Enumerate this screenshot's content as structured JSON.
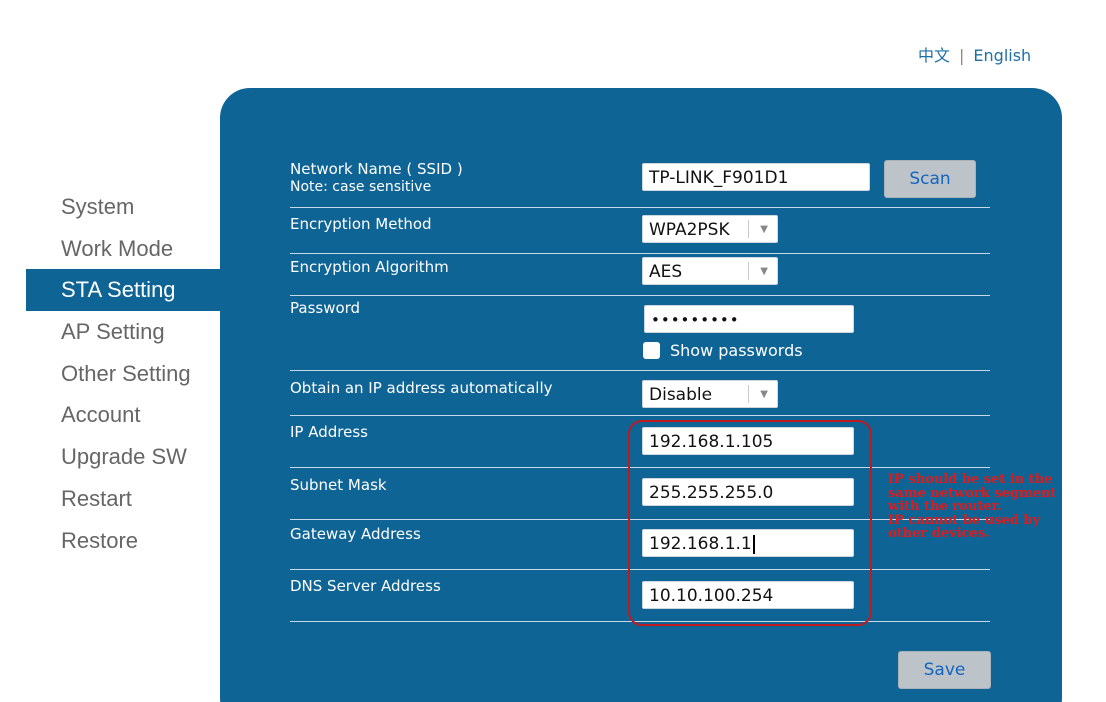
{
  "language": {
    "chinese": "中文",
    "separator": "|",
    "english": "English"
  },
  "sidebar": {
    "items": [
      {
        "label": "System"
      },
      {
        "label": "Work Mode"
      },
      {
        "label": "STA Setting",
        "active": true
      },
      {
        "label": "AP Setting"
      },
      {
        "label": "Other Setting"
      },
      {
        "label": "Account"
      },
      {
        "label": "Upgrade SW"
      },
      {
        "label": "Restart"
      },
      {
        "label": "Restore"
      }
    ]
  },
  "form": {
    "ssid": {
      "label": "Network Name ( SSID )",
      "note": "Note: case sensitive",
      "value": "TP-LINK_F901D1",
      "scan_label": "Scan"
    },
    "encryption_method": {
      "label": "Encryption Method",
      "value": "WPA2PSK"
    },
    "encryption_algorithm": {
      "label": "Encryption Algorithm",
      "value": "AES"
    },
    "password": {
      "label": "Password",
      "value": "•••••••••",
      "show_label": "Show passwords",
      "show_checked": false
    },
    "dhcp": {
      "label": "Obtain an IP address automatically",
      "value": "Disable"
    },
    "ip_address": {
      "label": "IP Address",
      "value": "192.168.1.105"
    },
    "subnet_mask": {
      "label": "Subnet Mask",
      "value": "255.255.255.0"
    },
    "gateway": {
      "label": "Gateway Address",
      "value": "192.168.1.1"
    },
    "dns": {
      "label": "DNS Server Address",
      "value": "10.10.100.254"
    },
    "save_label": "Save"
  },
  "annotation": {
    "lines": [
      "IP should be set in the",
      "same network segment",
      "with the router.",
      "IP cannot be used by",
      "other devices."
    ]
  },
  "colors": {
    "panel": "#0f6496",
    "annotation": "#e01a1a",
    "link": "#1d6fa5",
    "button": "#bcc3c9"
  }
}
